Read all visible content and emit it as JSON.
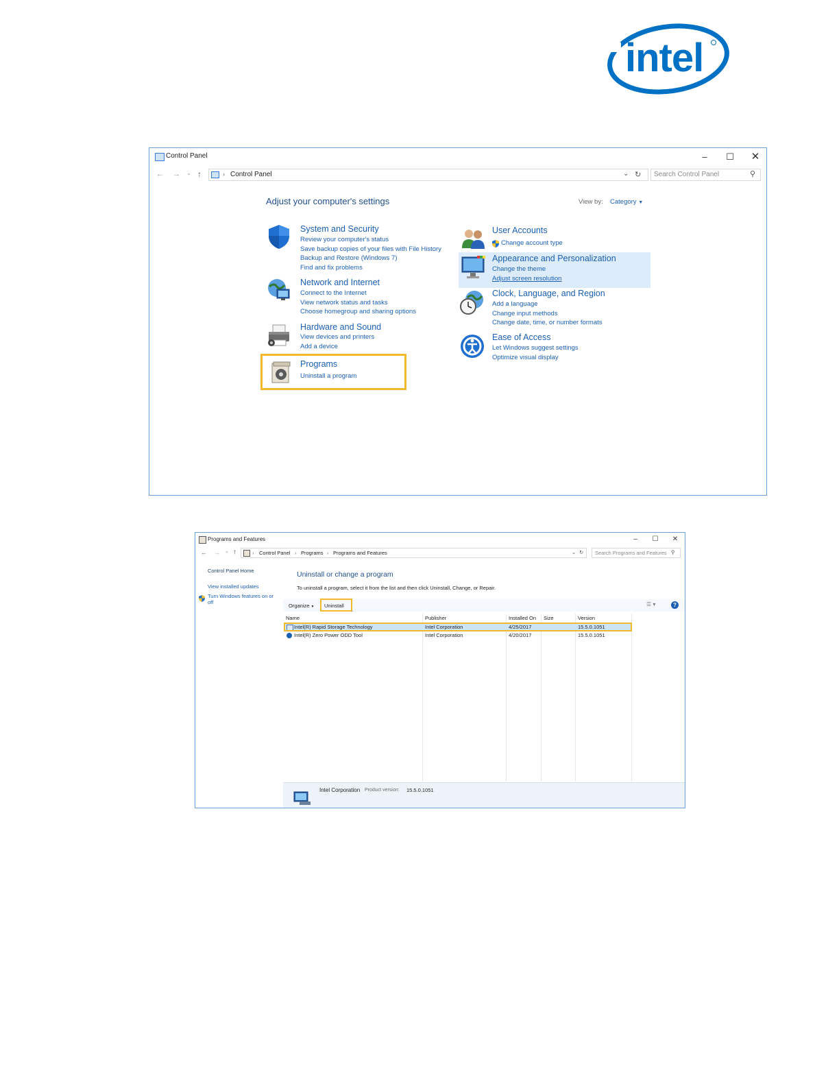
{
  "logo": {
    "text": "intel",
    "colors": {
      "brand": "#0071c5"
    }
  },
  "control_panel": {
    "window_title": "Control Panel",
    "breadcrumb": [
      "Control Panel"
    ],
    "search_placeholder": "Search Control Panel",
    "heading": "Adjust your computer's settings",
    "view_by_label": "View by:",
    "view_by_value": "Category",
    "categories": [
      {
        "title": "System and Security",
        "icon": "shield-icon",
        "links": [
          "Review your computer's status",
          "Save backup copies of your files with File History",
          "Backup and Restore (Windows 7)",
          "Find and fix problems"
        ]
      },
      {
        "title": "Network and Internet",
        "icon": "network-globe-icon",
        "links": [
          "Connect to the Internet",
          "View network status and tasks",
          "Choose homegroup and sharing options"
        ]
      },
      {
        "title": "Hardware and Sound",
        "icon": "printer-icon",
        "links": [
          "View devices and printers",
          "Add a device"
        ]
      },
      {
        "title": "Programs",
        "icon": "programs-disc-icon",
        "links": [
          "Uninstall a program"
        ]
      },
      {
        "title": "User Accounts",
        "icon": "users-icon",
        "links": [
          "Change account type"
        ]
      },
      {
        "title": "Appearance and Personalization",
        "icon": "monitor-paint-icon",
        "links": [
          "Change the theme",
          "Adjust screen resolution"
        ]
      },
      {
        "title": "Clock, Language, and Region",
        "icon": "clock-globe-icon",
        "links": [
          "Add a language",
          "Change input methods",
          "Change date, time, or number formats"
        ]
      },
      {
        "title": "Ease of Access",
        "icon": "ease-of-access-icon",
        "links": [
          "Let Windows suggest settings",
          "Optimize visual display"
        ]
      }
    ]
  },
  "programs_features": {
    "window_title": "Programs and Features",
    "breadcrumb": [
      "Control Panel",
      "Programs",
      "Programs and Features"
    ],
    "search_placeholder": "Search Programs and Features",
    "sidebar": [
      "Control Panel Home",
      "View installed updates",
      "Turn Windows features on or off"
    ],
    "heading": "Uninstall or change a program",
    "description": "To uninstall a program, select it from the list and then click Uninstall, Change, or Repair.",
    "toolbar": {
      "organize": "Organize",
      "uninstall": "Uninstall"
    },
    "columns": [
      "Name",
      "Publisher",
      "Installed On",
      "Size",
      "Version"
    ],
    "rows": [
      {
        "name": "Intel(R) Rapid Storage Technology",
        "publisher": "Intel Corporation",
        "installed_on": "4/25/2017",
        "size": "",
        "version": "15.5.0.1051",
        "selected": true
      },
      {
        "name": "Intel(R) Zero Power ODD Tool",
        "publisher": "Intel Corporation",
        "installed_on": "4/20/2017",
        "size": "",
        "version": "15.5.0.1051",
        "selected": false
      }
    ],
    "details": {
      "publisher": "Intel Corporation",
      "version_label": "Product version:",
      "version": "15.5.0.1051"
    }
  },
  "colors": {
    "highlight": "#f2b92c",
    "link": "#1a5fb4",
    "selection": "#cce4f7"
  }
}
